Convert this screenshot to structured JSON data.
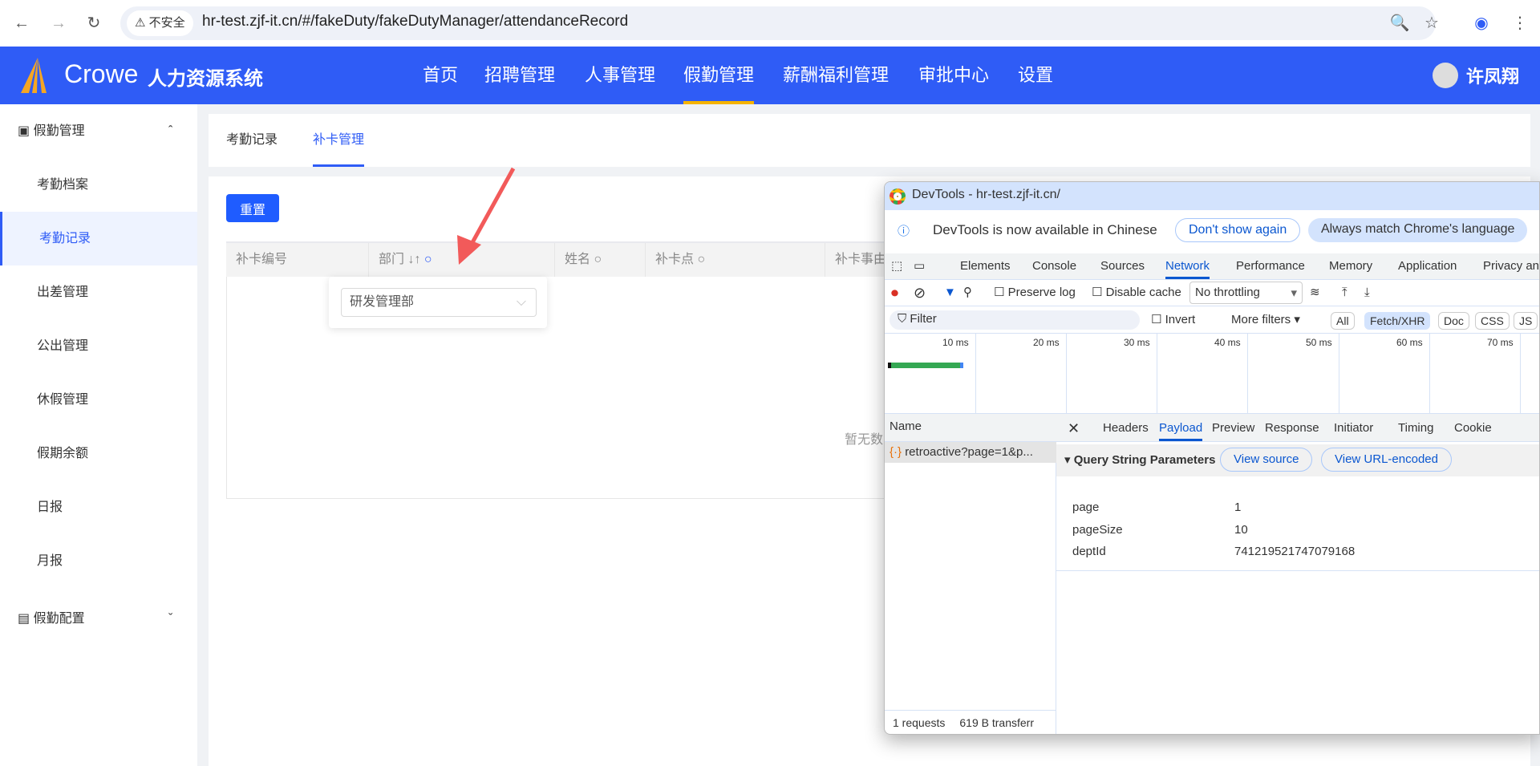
{
  "browser": {
    "back": "←",
    "forward": "→",
    "reload": "↻",
    "security": "⚠ 不安全",
    "url": "hr-test.zjf-it.cn/#/fakeDuty/fakeDutyManager/attendanceRecord",
    "zoom_icon": "🔍",
    "star_icon": "☆",
    "profile_icon": "◉",
    "menu_icon": "⋮"
  },
  "app": {
    "logo": "Crowe",
    "title": "人力资源系统",
    "accent": "#2f5cf6",
    "nav": [
      "首页",
      "招聘管理",
      "人事管理",
      "假勤管理",
      "薪酬福利管理",
      "审批中心",
      "设置"
    ],
    "user": "许凤翔"
  },
  "sidebar": {
    "group1": "假勤管理",
    "items": [
      "考勤档案",
      "考勤记录",
      "出差管理",
      "公出管理",
      "休假管理",
      "假期余额",
      "日报",
      "月报"
    ],
    "group2": "假勤配置"
  },
  "tabs": [
    "考勤记录",
    "补卡管理"
  ],
  "main": {
    "reset": "重置",
    "columns": [
      "补卡编号",
      "部门",
      "姓名",
      "补卡点",
      "补卡事由"
    ],
    "filter_value": "研发管理部",
    "empty": "暂无数"
  },
  "devtools": {
    "title": "DevTools - hr-test.zjf-it.cn/",
    "info": "DevTools is now available in Chinese",
    "dont_show": "Don't show again",
    "match": "Always match Chrome's language",
    "tabs": [
      "Elements",
      "Console",
      "Sources",
      "Network",
      "Performance",
      "Memory",
      "Application",
      "Privacy an"
    ],
    "preserve": "Preserve log",
    "disable_cache": "Disable cache",
    "throttling": "No throttling",
    "filter": "Filter",
    "invert": "Invert",
    "more_filters": "More filters ▾",
    "types": [
      "All",
      "Fetch/XHR",
      "Doc",
      "CSS",
      "JS"
    ],
    "ticks": [
      "10 ms",
      "20 ms",
      "30 ms",
      "40 ms",
      "50 ms",
      "60 ms",
      "70 ms"
    ],
    "name_header": "Name",
    "request": "retroactive?page=1&p...",
    "detail_tabs": [
      "Headers",
      "Payload",
      "Preview",
      "Response",
      "Initiator",
      "Timing",
      "Cookie"
    ],
    "qsp": "Query String Parameters",
    "view_source": "View source",
    "view_url": "View URL-encoded",
    "params": [
      {
        "k": "page",
        "v": "1"
      },
      {
        "k": "pageSize",
        "v": "10"
      },
      {
        "k": "deptId",
        "v": "741219521747079168"
      }
    ],
    "requests": "1 requests",
    "transferred": "619 B transferr"
  }
}
